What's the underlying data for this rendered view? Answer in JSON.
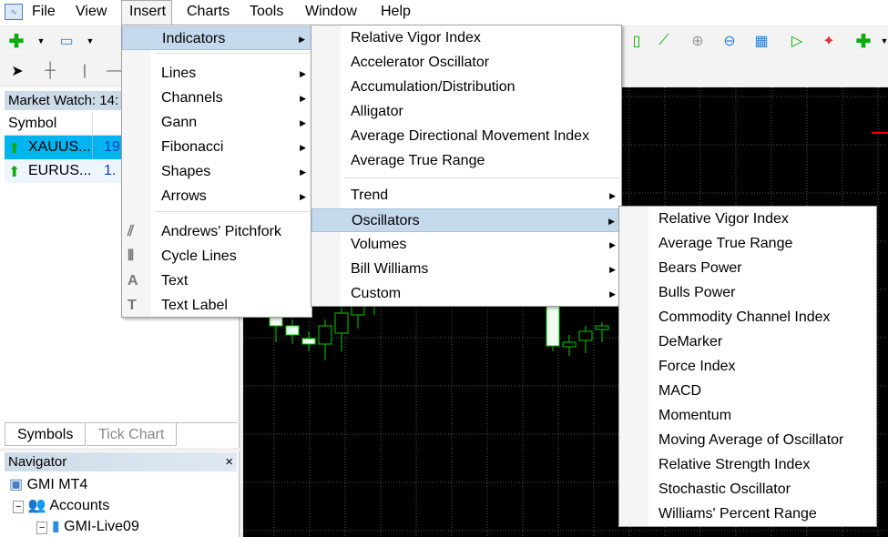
{
  "menubar": {
    "items": [
      "File",
      "View",
      "Insert",
      "Charts",
      "Tools",
      "Window",
      "Help"
    ]
  },
  "market_watch": {
    "title": "Market Watch: 14:",
    "column_symbol": "Symbol",
    "rows": [
      {
        "symbol": "XAUUS...",
        "bid": "19",
        "selected": true
      },
      {
        "symbol": "EURUS...",
        "bid": "1.",
        "selected": false
      }
    ],
    "tabs": [
      "Symbols",
      "Tick Chart"
    ]
  },
  "navigator": {
    "title": "Navigator",
    "close": "×",
    "tree": [
      "GMI MT4",
      "Accounts",
      "GMI-Live09"
    ]
  },
  "insert_menu": {
    "items": [
      {
        "label": "Indicators",
        "submenu": true
      },
      {
        "label": "Lines",
        "submenu": true
      },
      {
        "label": "Channels",
        "submenu": true
      },
      {
        "label": "Gann",
        "submenu": true
      },
      {
        "label": "Fibonacci",
        "submenu": true
      },
      {
        "label": "Shapes",
        "submenu": true
      },
      {
        "label": "Arrows",
        "submenu": true
      },
      {
        "label": "Andrews' Pitchfork",
        "icon": "pitchfork-icon"
      },
      {
        "label": "Cycle Lines",
        "icon": "cycle-lines-icon"
      },
      {
        "label": "Text",
        "icon": "text-icon",
        "glyph": "A"
      },
      {
        "label": "Text Label",
        "icon": "text-label-icon",
        "glyph": "T"
      }
    ]
  },
  "indicators_menu": {
    "items": [
      "Relative Vigor Index",
      "Accelerator Oscillator",
      "Accumulation/Distribution",
      "Alligator",
      "Average Directional Movement Index",
      "Average True Range"
    ],
    "groups": [
      "Trend",
      "Oscillators",
      "Volumes",
      "Bill Williams",
      "Custom"
    ]
  },
  "oscillators_menu": {
    "items": [
      "Relative Vigor Index",
      "Average True Range",
      "Bears Power",
      "Bulls Power",
      "Commodity Channel Index",
      "DeMarker",
      "Force Index",
      "MACD",
      "Momentum",
      "Moving Average of Oscillator",
      "Relative Strength Index",
      "Stochastic Oscillator",
      "Williams' Percent Range"
    ]
  },
  "colors": {
    "highlight": "#c5d9ec",
    "selected_row": "#00b4f0",
    "bull": "#00c000",
    "chart_bg": "#000000"
  }
}
